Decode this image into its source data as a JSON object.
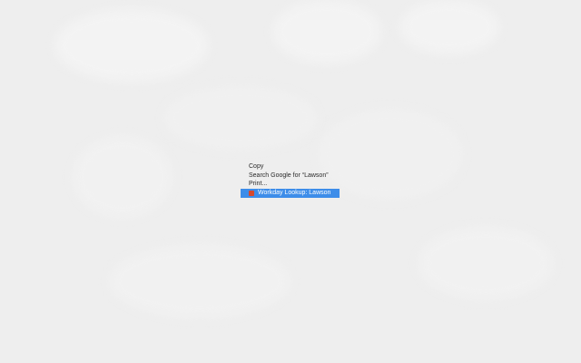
{
  "context_menu": {
    "items": [
      {
        "label": "Copy"
      },
      {
        "label": "Search Google for “Lawson”"
      },
      {
        "label": "Print..."
      },
      {
        "label": "Workday Lookup: Lawson",
        "icon": "workday-extension-icon",
        "highlighted": true
      }
    ],
    "highlight_color": "#3d8de9",
    "icon_color": "#d6492d"
  }
}
